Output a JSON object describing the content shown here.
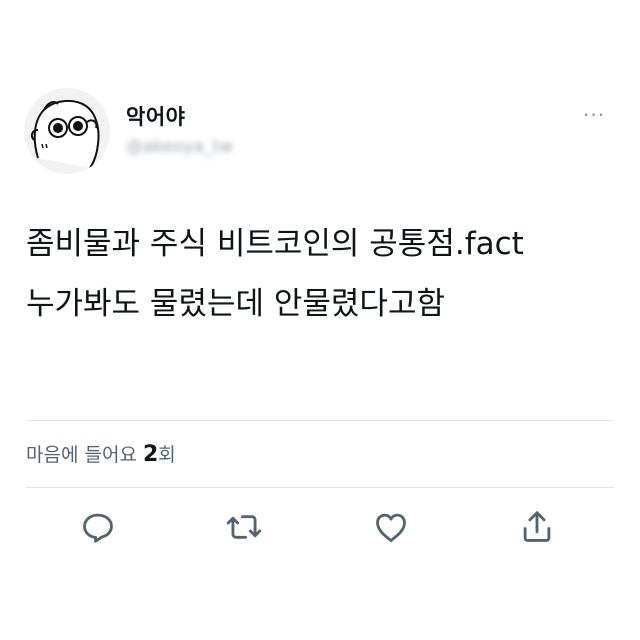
{
  "tweet": {
    "display_name": "악어야",
    "handle": "@akeoya_tw",
    "more_label": "···",
    "lines": [
      "좀비물과 주식 비트코인의 공통점.fact",
      "누가봐도 물렸는데 안물렸다고함"
    ]
  },
  "stats": {
    "likes_label": "마음에 들어요",
    "likes_count": "2",
    "likes_suffix": "회"
  },
  "actions": [
    "reply-icon",
    "retweet-icon",
    "like-icon",
    "share-icon"
  ]
}
